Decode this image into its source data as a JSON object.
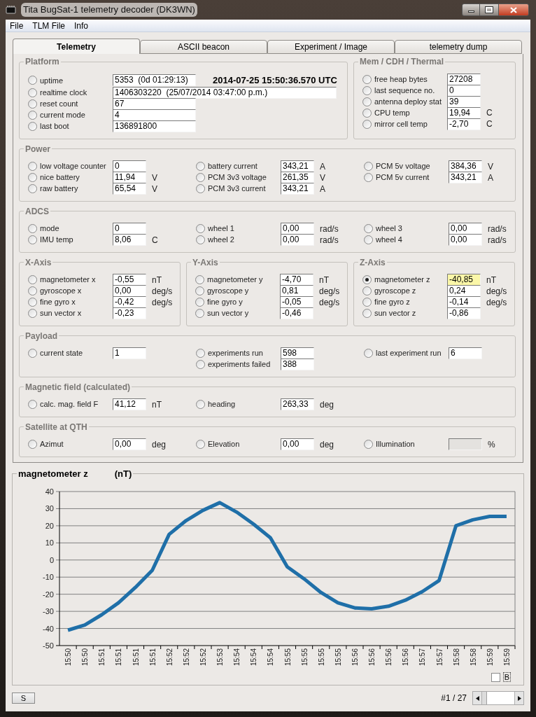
{
  "window": {
    "title": "Tita BugSat-1 telemetry decoder (DK3WN)"
  },
  "menu": [
    "File",
    "TLM File",
    "Info"
  ],
  "tabs": [
    {
      "label": "Telemetry",
      "selected": true
    },
    {
      "label": "ASCII beacon",
      "selected": false
    },
    {
      "label": "Experiment / Image",
      "selected": false
    },
    {
      "label": "telemetry dump",
      "selected": false
    }
  ],
  "group_rows": [
    [
      {
        "title": "Platform",
        "timestamp": "2014-07-25 15:50:36.570 UTC",
        "columns": [
          [
            {
              "kind": "field",
              "label": "uptime",
              "value": "5353  (0d 01:29:13)",
              "selected": false
            },
            {
              "kind": "wide_field",
              "label": "realtime clock",
              "value": "1406303220  (25/07/2014 03:47:00 p.m.)",
              "selected": false
            },
            {
              "kind": "field",
              "label": "reset count",
              "value": "67",
              "selected": false
            },
            {
              "kind": "field",
              "label": "current mode",
              "value": "4",
              "selected": false
            },
            {
              "kind": "field",
              "label": "last boot",
              "value": "136891800",
              "selected": false
            }
          ]
        ]
      },
      {
        "title": "Mem / CDH / Thermal",
        "columns": [
          [
            {
              "label": "free heap bytes",
              "value": "27208",
              "selected": false
            },
            {
              "label": "last sequence no.",
              "value": "0",
              "selected": false
            },
            {
              "label": "antenna deploy stat",
              "value": "39",
              "selected": false
            },
            {
              "label": "CPU temp",
              "value": "19,94",
              "unit": "C",
              "selected": false
            },
            {
              "label": "mirror cell temp",
              "value": "-2,70",
              "unit": "C",
              "selected": false
            }
          ]
        ]
      }
    ],
    [
      {
        "title": "Power",
        "columns": [
          [
            {
              "label": "low voltage counter",
              "value": "0",
              "selected": false
            },
            {
              "label": "nice battery",
              "value": "11,94",
              "unit": "V",
              "selected": false
            },
            {
              "label": "raw battery",
              "value": "65,54",
              "unit": "V",
              "selected": false
            }
          ],
          [
            {
              "label": "battery current",
              "value": "343,21",
              "unit": "A",
              "selected": false
            },
            {
              "label": "PCM 3v3 voltage",
              "value": "261,35",
              "unit": "V",
              "selected": false
            },
            {
              "label": "PCM 3v3 current",
              "value": "343,21",
              "unit": "A",
              "selected": false
            }
          ],
          [
            {
              "label": "PCM 5v voltage",
              "value": "384,36",
              "unit": "V",
              "selected": false
            },
            {
              "label": "PCM 5v current",
              "value": "343,21",
              "unit": "A",
              "selected": false
            }
          ]
        ]
      }
    ],
    [
      {
        "title": "ADCS",
        "columns": [
          [
            {
              "label": "mode",
              "value": "0",
              "selected": false
            },
            {
              "label": "IMU temp",
              "value": "8,06",
              "unit": "C",
              "selected": false
            }
          ],
          [
            {
              "label": "wheel 1",
              "value": "0,00",
              "unit": "rad/s",
              "selected": false
            },
            {
              "label": "wheel 2",
              "value": "0,00",
              "unit": "rad/s",
              "selected": false
            }
          ],
          [
            {
              "label": "wheel 3",
              "value": "0,00",
              "unit": "rad/s",
              "selected": false
            },
            {
              "label": "wheel 4",
              "value": "0,00",
              "unit": "rad/s",
              "selected": false
            }
          ]
        ]
      }
    ],
    [
      {
        "title": "X-Axis",
        "columns": [
          [
            {
              "label": "magnetometer x",
              "value": "-0,55",
              "unit": "nT",
              "selected": false
            },
            {
              "label": "gyroscope x",
              "value": "0,00",
              "unit": "deg/s",
              "selected": false
            },
            {
              "label": "fine gyro x",
              "value": "-0,42",
              "unit": "deg/s",
              "selected": false
            },
            {
              "label": "sun vector x",
              "value": "-0,23",
              "selected": false
            }
          ]
        ]
      },
      {
        "title": "Y-Axis",
        "columns": [
          [
            {
              "label": "magnetometer y",
              "value": "-4,70",
              "unit": "nT",
              "selected": false
            },
            {
              "label": "gyroscope y",
              "value": "0,81",
              "unit": "deg/s",
              "selected": false
            },
            {
              "label": "fine gyro y",
              "value": "-0,05",
              "unit": "deg/s",
              "selected": false
            },
            {
              "label": "sun vector y",
              "value": "-0,46",
              "selected": false
            }
          ]
        ]
      },
      {
        "title": "Z-Axis",
        "columns": [
          [
            {
              "label": "magnetometer z",
              "value": "-40,85",
              "unit": "nT",
              "selected": true
            },
            {
              "label": "gyroscope z",
              "value": "0,24",
              "unit": "deg/s",
              "selected": false
            },
            {
              "label": "fine gyro z",
              "value": "-0,14",
              "unit": "deg/s",
              "selected": false
            },
            {
              "label": "sun vector z",
              "value": "-0,86",
              "selected": false
            }
          ]
        ]
      }
    ],
    [
      {
        "title": "Payload",
        "columns": [
          [
            {
              "label": "current state",
              "value": "1",
              "selected": false
            }
          ],
          [
            {
              "label": "experiments run",
              "value": "598",
              "selected": false
            },
            {
              "label": "experiments failed",
              "value": "388",
              "selected": false
            }
          ],
          [
            {
              "label": "last experiment run",
              "value": "6",
              "selected": false
            }
          ]
        ]
      }
    ],
    [
      {
        "title": "Magnetic field (calculated)",
        "columns": [
          [
            {
              "label": "calc. mag. field F",
              "value": "41,12",
              "unit": "nT",
              "selected": false
            }
          ],
          [
            {
              "label": "heading",
              "value": "263,33",
              "unit": "deg",
              "selected": false
            }
          ]
        ]
      }
    ],
    [
      {
        "title": "Satellite at QTH",
        "columns": [
          [
            {
              "label": "Azimut",
              "value": "0,00",
              "unit": "deg",
              "selected": false
            }
          ],
          [
            {
              "label": "Elevation",
              "value": "0,00",
              "unit": "deg",
              "selected": false
            }
          ],
          [
            {
              "label": "Illumination",
              "unit": "%",
              "selected": false
            }
          ]
        ]
      }
    ]
  ],
  "chart": {
    "chart_data": {
      "type": "line",
      "ylabel": "(nT)",
      "grid": true,
      "categories": [
        "15:50",
        "15:50",
        "15:51",
        "15:51",
        "15:51",
        "15:51",
        "15:52",
        "15:52",
        "15:52",
        "15:53",
        "15:54",
        "15:54",
        "15:54",
        "15:55",
        "15:55",
        "15:55",
        "15:55",
        "15:56",
        "15:56",
        "15:56",
        "15:56",
        "15:57",
        "15:57",
        "15:58",
        "15:58",
        "15:59",
        "15:59"
      ],
      "series": [
        {
          "name": "magnetometer z",
          "color": "#1f6fa8",
          "values": [
            -41,
            -38,
            -32,
            -25,
            -16,
            -6,
            15,
            23,
            29,
            33.5,
            28,
            21,
            13,
            -4,
            -11,
            -19,
            -25,
            -28,
            -28.5,
            -27,
            -23.5,
            -18.5,
            -12,
            20,
            23.5,
            25.5,
            25.5
          ]
        }
      ],
      "ylim": [
        -50,
        40
      ],
      "yticks": [
        -50,
        -40,
        -30,
        -20,
        -10,
        0,
        10,
        20,
        30,
        40
      ]
    },
    "checkbox": {
      "label": "B",
      "checked": false
    }
  },
  "footer": {
    "button": "S",
    "record": "#1 / 27"
  }
}
